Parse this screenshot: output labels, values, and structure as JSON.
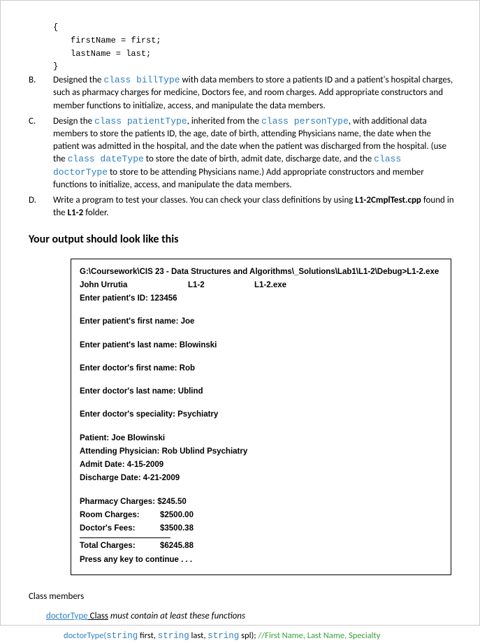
{
  "code": {
    "brace_open": "{",
    "line1": "firstName = first;",
    "line2": "lastName = last;",
    "brace_close": "}"
  },
  "items": {
    "B": {
      "label": "B.",
      "pre": "Designed the ",
      "kw1": "class billType",
      "post1": " with data members to store a patients ID and a patient's hospital charges, such as pharmacy charges for medicine, Doctors fee, and room charges.  Add appropriate constructors and member functions to initialize, access, and manipulate the data members."
    },
    "C": {
      "label": "C.",
      "pre": "Design the ",
      "kw1": "class patientType",
      "mid1": ", inherited from the ",
      "kw2": "class personType",
      "mid2": ", with additional data members to store the patients ID, the age, date of birth, attending Physicians name, the date when the patient was admitted in the hospital, and the date when the patient was discharged from the hospital.  (use the ",
      "kw3": "class dateType",
      "mid3": " to store the date of birth, admit date, discharge date, and the ",
      "kw4": "class doctorType",
      "post": " to store to be attending Physicians name.) Add appropriate constructors and member functions to initialize, access, and manipulate the data members."
    },
    "D": {
      "label": "D.",
      "pre": "Write a program to test your classes. You can check your class definitions by using ",
      "ref1": "L1-2CmplTest.cpp",
      "mid": " found in the ",
      "ref2": "L1-2",
      "post": " folder."
    }
  },
  "output_heading": "Your output should look like this",
  "output": {
    "path": "G:\\Coursework\\CIS 23 - Data Structures and Algorithms\\_Solutions\\Lab1\\L1-2\\Debug>L1-2.exe",
    "header": {
      "name": "John Urrutia",
      "lab": "L1-2",
      "exe": "L1-2.exe"
    },
    "id": "Enter patient's ID: 123456",
    "pfirst": "Enter patient's first name: Joe",
    "plast": "Enter patient's last name: Blowinski",
    "dfirst": "Enter doctor's first name: Rob",
    "dlast": "Enter doctor's last name: Ublind",
    "dspec": "Enter doctor's speciality: Psychiatry",
    "patient": "Patient: Joe Blowinski",
    "physician": "Attending Physician: Rob Ublind Psychiatry",
    "admit": "Admit Date: 4-15-2009",
    "discharge": "Discharge Date: 4-21-2009",
    "pharmacy": "Pharmacy Charges: $245.50",
    "room_label": "Room Charges:",
    "room_val": "$2500.00",
    "doctor_label": "Doctor's Fees:",
    "doctor_val": "$3500.38",
    "total_label": "Total Charges:",
    "total_val": "$6245.88",
    "continue": "Press any key to continue . . ."
  },
  "members": {
    "heading": "Class members",
    "doctor_class": "doctorType",
    "doctor_rest": " Class",
    "doctor_italic": " must contain at least these functions",
    "sig": {
      "name": "doctorType(",
      "p1t": "string",
      "p1n": " first, ",
      "p2t": "string",
      "p2n": " last, ",
      "p3t": "string",
      "p3n": " spl); ",
      "comment": "//First Name, Last Name, Specialty"
    }
  }
}
